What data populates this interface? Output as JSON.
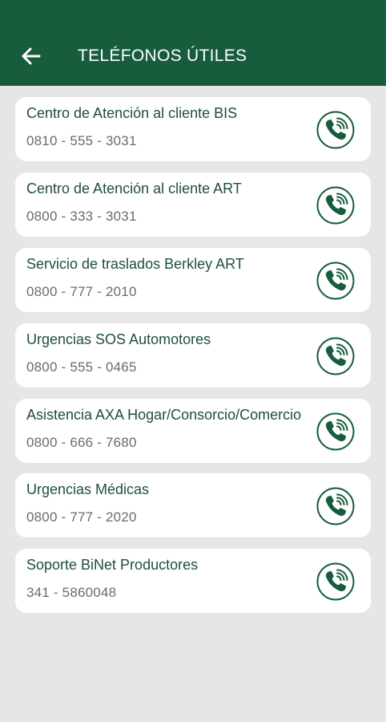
{
  "header": {
    "title": "TELÉFONOS ÚTILES",
    "back_icon": "arrow-left-icon",
    "background": "#175c3d"
  },
  "contacts": [
    {
      "name": "Centro de Atención al cliente BIS",
      "phone": "0810 - 555 - 3031"
    },
    {
      "name": "Centro de Atención al cliente ART",
      "phone": "0800 - 333 - 3031"
    },
    {
      "name": "Servicio de traslados Berkley ART",
      "phone": "0800 - 777 - 2010"
    },
    {
      "name": "Urgencias SOS Automotores",
      "phone": "0800 - 555 - 0465"
    },
    {
      "name": "Asistencia AXA Hogar/Consorcio/Comercio",
      "phone": "0800 - 666 - 7680"
    },
    {
      "name": "Urgencias Médicas",
      "phone": "0800 - 777 - 2020"
    },
    {
      "name": "Soporte BiNet Productores",
      "phone": "341 - 5860048"
    }
  ],
  "call_icon": "phone-call-icon",
  "colors": {
    "accent": "#175c3d",
    "background": "#e6e6e6",
    "card": "#ffffff",
    "name_text": "#1f4f3a",
    "number_text": "#6b6b6b"
  }
}
